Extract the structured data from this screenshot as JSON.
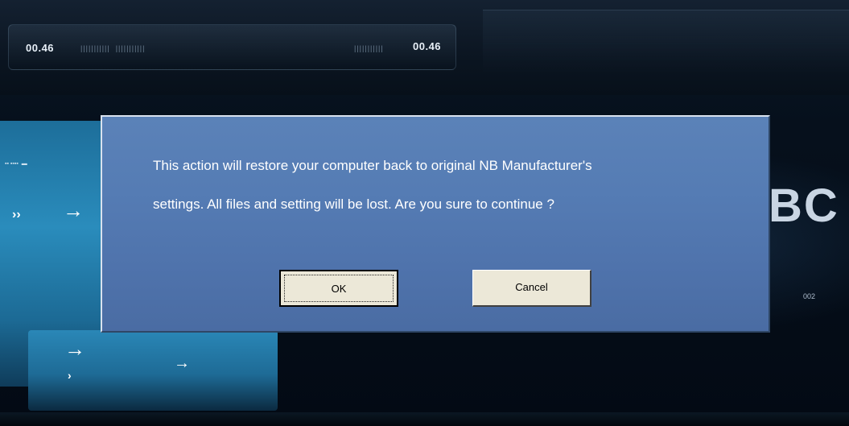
{
  "background": {
    "timer_left": "00.46",
    "timer_right": "00.46",
    "brand_fragment": "BC",
    "right_small_text": "002"
  },
  "dialog": {
    "message_line1": "This action will restore your computer back to original NB Manufacturer's",
    "message_line2": "settings. All files and setting will be lost. Are you sure to continue ?",
    "ok_label": "OK",
    "cancel_label": "Cancel"
  },
  "colors": {
    "dialog_background": "#557cb4",
    "button_face": "#ece8d8",
    "message_text": "#ffffff"
  }
}
